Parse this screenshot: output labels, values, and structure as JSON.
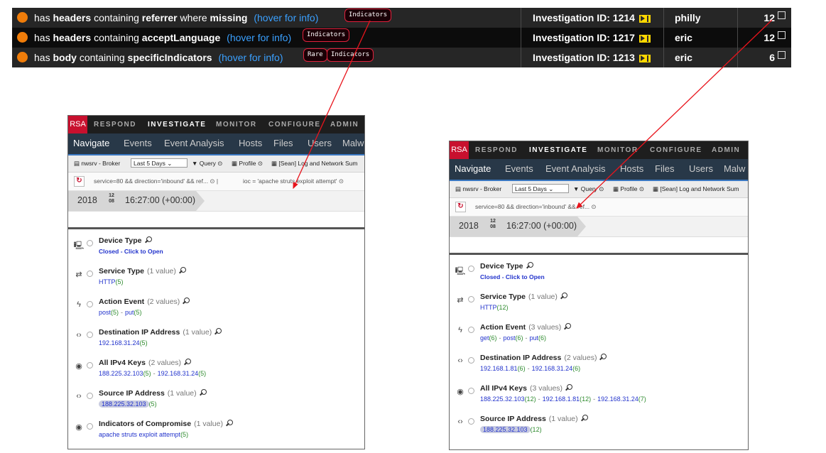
{
  "alerts": [
    {
      "rule": [
        [
          "has",
          "w"
        ],
        [
          "headers",
          "b"
        ],
        [
          "containing",
          "w"
        ],
        [
          "referrer",
          "b"
        ],
        [
          "where",
          "w"
        ],
        [
          "missing",
          "b"
        ]
      ],
      "hover": "(hover for info)",
      "tags": [
        "Indicators"
      ],
      "investigation": "Investigation ID: 1214",
      "user": "philly",
      "count": "12"
    },
    {
      "rule": [
        [
          "has",
          "w"
        ],
        [
          "headers",
          "b"
        ],
        [
          "containing",
          "w"
        ],
        [
          "acceptLanguage",
          "b"
        ]
      ],
      "hover": "(hover for info)",
      "tags": [
        "Indicators"
      ],
      "investigation": "Investigation ID: 1217",
      "user": "eric",
      "count": "12"
    },
    {
      "rule": [
        [
          "has",
          "w"
        ],
        [
          "body",
          "b"
        ],
        [
          "containing",
          "w"
        ],
        [
          "specificIndicators",
          "b"
        ]
      ],
      "hover": "(hover for info)",
      "tags": [
        "Rare",
        "Indicators"
      ],
      "investigation": "Investigation ID: 1213",
      "user": "eric",
      "count": "6"
    }
  ],
  "panel_left": {
    "logo": "RSA",
    "top_nav": [
      "RESPOND",
      "INVESTIGATE",
      "MONITOR",
      "CONFIGURE",
      "ADMIN"
    ],
    "active_top": "INVESTIGATE",
    "sub_nav": [
      "Navigate",
      "Events",
      "Event Analysis",
      "Hosts",
      "Files",
      "Users",
      "Malw"
    ],
    "active_sub": "Navigate",
    "toolbar": {
      "service": "nwsrv - Broker",
      "range": "Last 5 Days",
      "query": "Query",
      "profile": "Profile",
      "profile_value": "[Sean] Log and Network Sum"
    },
    "query_parts": [
      "service=80 && direction='inbound' && ref...",
      "ioc = 'apache struts exploit attempt'"
    ],
    "date": {
      "year": "2018",
      "month": "12",
      "day": "08",
      "time": "16:27:00 (+00:00)"
    },
    "meta": [
      {
        "icon": "device-icon",
        "title": "Device Type",
        "count": "",
        "closed": "Closed - Click to Open"
      },
      {
        "icon": "service-icon",
        "title": "Service Type",
        "count": "(1 value)",
        "values": [
          [
            "HTTP",
            "(5)"
          ]
        ]
      },
      {
        "icon": "action-icon",
        "title": "Action Event",
        "count": "(2 values)",
        "values": [
          [
            "post",
            "(5)"
          ],
          [
            "put",
            "(5)"
          ]
        ]
      },
      {
        "icon": "ip-icon",
        "title": "Destination IP Address",
        "count": "(1 value)",
        "values": [
          [
            "192.168.31.24",
            "(5)"
          ]
        ]
      },
      {
        "icon": "globe-icon",
        "title": "All IPv4 Keys",
        "count": "(2 values)",
        "values": [
          [
            "188.225.32.103",
            "(5)"
          ],
          [
            "192.168.31.24",
            "(5)"
          ]
        ]
      },
      {
        "icon": "ip-icon",
        "title": "Source IP Address",
        "count": "(1 value)",
        "values": [
          [
            "188.225.32.103",
            "(5)"
          ]
        ],
        "highlight": true
      },
      {
        "icon": "globe-icon",
        "title": "Indicators of Compromise",
        "count": "(1 value)",
        "values": [
          [
            "apache struts exploit attempt",
            "(5)"
          ]
        ]
      }
    ]
  },
  "panel_right": {
    "logo": "RSA",
    "top_nav": [
      "RESPOND",
      "INVESTIGATE",
      "MONITOR",
      "CONFIGURE",
      "ADMIN"
    ],
    "active_top": "INVESTIGATE",
    "sub_nav": [
      "Navigate",
      "Events",
      "Event Analysis",
      "Hosts",
      "Files",
      "Users",
      "Malw"
    ],
    "active_sub": "Navigate",
    "toolbar": {
      "service": "nwsrv - Broker",
      "range": "Last 5 Days",
      "query": "Query",
      "profile": "Profile",
      "profile_value": "[Sean] Log and Network Sum"
    },
    "query_parts": [
      "service=80 && direction='inbound' && ref..."
    ],
    "date": {
      "year": "2018",
      "month": "12",
      "day": "08",
      "time": "16:27:00 (+00:00)"
    },
    "meta": [
      {
        "icon": "device-icon",
        "title": "Device Type",
        "count": "",
        "closed": "Closed - Click to Open"
      },
      {
        "icon": "service-icon",
        "title": "Service Type",
        "count": "(1 value)",
        "values": [
          [
            "HTTP",
            "(12)"
          ]
        ]
      },
      {
        "icon": "action-icon",
        "title": "Action Event",
        "count": "(3 values)",
        "values": [
          [
            "get",
            "(6)"
          ],
          [
            "post",
            "(6)"
          ],
          [
            "put",
            "(6)"
          ]
        ]
      },
      {
        "icon": "ip-icon",
        "title": "Destination IP Address",
        "count": "(2 values)",
        "values": [
          [
            "192.168.1.81",
            "(6)"
          ],
          [
            "192.168.31.24",
            "(6)"
          ]
        ]
      },
      {
        "icon": "globe-icon",
        "title": "All IPv4 Keys",
        "count": "(3 values)",
        "values": [
          [
            "188.225.32.103",
            "(12)"
          ],
          [
            "192.168.1.81",
            "(12)"
          ],
          [
            "192.168.31.24",
            "(7)"
          ]
        ]
      },
      {
        "icon": "ip-icon",
        "title": "Source IP Address",
        "count": "(1 value)",
        "values": [
          [
            "188.225.32.103",
            "(12)"
          ]
        ],
        "highlight": true
      }
    ]
  },
  "colors": {
    "alert_dot": "#f07d0a",
    "link": "#3aa0ff",
    "tag_border": "#e0213b",
    "annotation_arrow": "#e8141c",
    "rsa_red": "#c8102e"
  }
}
